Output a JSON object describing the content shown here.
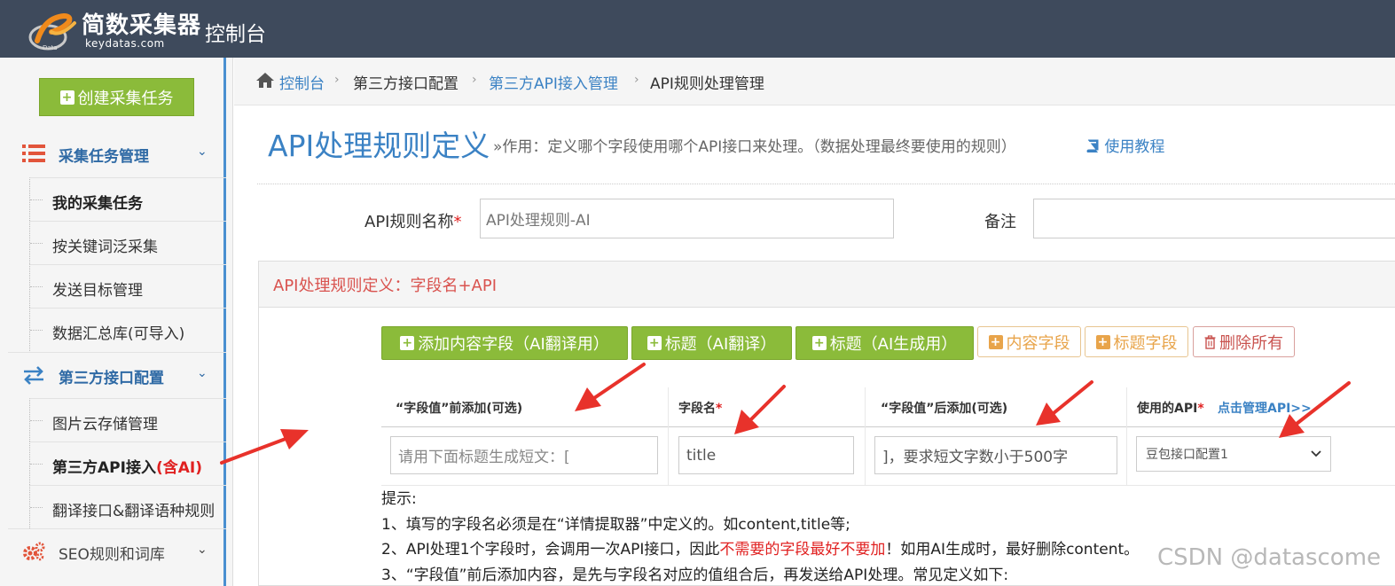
{
  "app": {
    "logo_text": "简数采集器",
    "logo_sub": "keydatas.com",
    "title": "控制台"
  },
  "sidebar": {
    "create_button": "创建采集任务",
    "groups": [
      {
        "label": "采集任务管理",
        "items": [
          {
            "label": "我的采集任务"
          },
          {
            "label": "按关键词泛采集"
          },
          {
            "label": "发送目标管理"
          },
          {
            "label": "数据汇总库(可导入)"
          }
        ]
      },
      {
        "label": "第三方接口配置",
        "items": [
          {
            "label": "图片云存储管理"
          },
          {
            "label": "第三方API接入",
            "suffix": "(含AI)"
          },
          {
            "label": "翻译接口&翻译语种规则"
          }
        ]
      },
      {
        "label": "SEO规则和词库"
      }
    ]
  },
  "breadcrumb": [
    "控制台",
    "第三方接口配置",
    "第三方API接入管理",
    "API规则处理管理"
  ],
  "page": {
    "title": "API处理规则定义",
    "description": "»作用：定义哪个字段使用哪个API接口来处理。（数据处理最终要使用的规则）",
    "tutorial": "使用教程"
  },
  "form": {
    "name_label": "API规则名称",
    "required_mark": "*",
    "name_value": "API处理规则-AI",
    "remark_label": "备注",
    "remark_value": ""
  },
  "panel": {
    "title": "API处理规则定义：字段名+API",
    "buttons": {
      "add_content": "添加内容字段（AI翻译用）",
      "title_translate": "标题（AI翻译）",
      "title_generate": "标题（AI生成用）",
      "content_field": "内容字段",
      "title_field": "标题字段",
      "delete_all": "删除所有"
    },
    "columns": {
      "prefix": "“字段值”前添加(可选)",
      "field": "字段名",
      "suffix": "“字段值”后添加(可选)",
      "api": "使用的API",
      "manage_link": "点击管理API>>"
    },
    "row": {
      "prefix_placeholder": "请用下面标题生成短文：[",
      "field_value": "title",
      "suffix_value": "]，要求短文字数小于500字",
      "api_selected": "豆包接口配置1"
    },
    "tips": {
      "heading": "提示:",
      "line1": "1、填写的字段名必须是在“详情提取器”中定义的。如content,title等;",
      "line2_a": "2、API处理1个字段时，会调用一次API接口，因此",
      "line2_red": "不需要的字段最好不要加",
      "line2_b": "！如用AI生成时，最好删除content。",
      "line3": "3、“字段值”前后添加内容，是先与字段名对应的值组合后，再发送给API处理。常见定义如下:"
    }
  },
  "watermark": "CSDN @datascome",
  "colors": {
    "topbar": "#3e4a5c",
    "green": "#8bbb3a",
    "link_blue": "#3b82c4",
    "red": "#e02020",
    "annotation_arrow": "#e8322b"
  }
}
